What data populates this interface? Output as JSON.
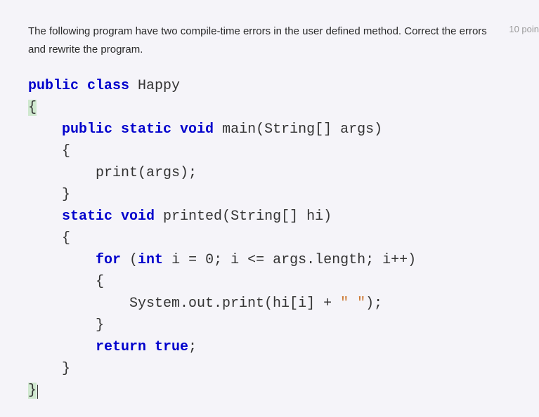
{
  "question": {
    "text": "The following program have two compile-time errors in the user defined method. Correct the errors and rewrite the program.",
    "points": "10 poin"
  },
  "code": {
    "line1_kw": "public class",
    "line1_name": " Happy",
    "line2_brace": "{",
    "line3_indent": "    ",
    "line3_kw": "public static void",
    "line3_rest": " main(String[] args)",
    "line4": "    {",
    "line5": "        print(args);",
    "line6": "    }",
    "line7_indent": "    ",
    "line7_kw": "static void",
    "line7_rest": " printed(String[] hi)",
    "line8": "    {",
    "line9_indent": "        ",
    "line9_kw": "for",
    "line9_paren": " (",
    "line9_int": "int",
    "line9_rest": " i = 0; i <= args.length; i++)",
    "line10": "        {",
    "line11_indent": "            System.out.print(hi[i] + ",
    "line11_str": "\" \"",
    "line11_end": ");",
    "line12": "        }",
    "line13_indent": "        ",
    "line13_kw": "return true",
    "line13_end": ";",
    "line14": "    }",
    "line15_brace": "}"
  }
}
